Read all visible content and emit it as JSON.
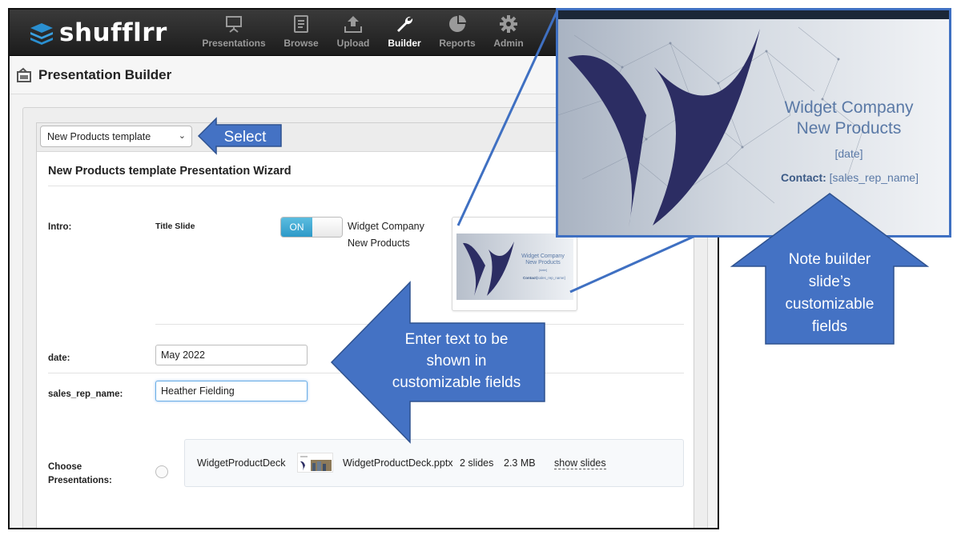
{
  "app": {
    "brand": "shufflrr",
    "nav": [
      {
        "label": "Presentations",
        "icon": "presentation-icon",
        "active": false
      },
      {
        "label": "Browse",
        "icon": "browse-icon",
        "active": false
      },
      {
        "label": "Upload",
        "icon": "upload-icon",
        "active": false
      },
      {
        "label": "Builder",
        "icon": "wrench-icon",
        "active": true
      },
      {
        "label": "Reports",
        "icon": "pie-chart-icon",
        "active": false
      },
      {
        "label": "Admin",
        "icon": "gear-icon",
        "active": false
      }
    ]
  },
  "page": {
    "title": "Presentation Builder"
  },
  "builder": {
    "template_select": {
      "value": "New Products template"
    },
    "wizard_title": "New Products template Presentation Wizard",
    "intro": {
      "label": "Intro:",
      "slide_label": "Title Slide",
      "toggle": "ON",
      "toggle_state": true,
      "preview_lines": [
        "Widget Company",
        "New Products"
      ],
      "thumb": {
        "title_lines": [
          "Widget Company",
          "New Products"
        ],
        "date": "[date]",
        "contact_label": "Contact:",
        "contact_value": "[sales_rep_name]"
      }
    },
    "fields": [
      {
        "label": "date:",
        "value": "May 2022"
      },
      {
        "label": "sales_rep_name:",
        "value": "Heather Fielding"
      }
    ],
    "choose": {
      "label_lines": [
        "Choose",
        "Presentations:"
      ],
      "deck_name": "WidgetProductDeck",
      "file_name": "WidgetProductDeck.pptx",
      "slides": "2 slides",
      "size": "2.3 MB",
      "link": "show slides"
    }
  },
  "preview": {
    "title_lines": [
      "Widget Company",
      "New Products"
    ],
    "date": "[date]",
    "contact_label": "Contact:",
    "contact_value": "[sales_rep_name]"
  },
  "annotations": {
    "select": "Select",
    "enter_text": [
      "Enter text to be",
      "shown in",
      "customizable fields"
    ],
    "note": [
      "Note builder",
      "slide’s",
      "customizable",
      "fields"
    ]
  },
  "colors": {
    "callout": "#4472c4",
    "callout_stroke": "#2f528f",
    "toggle_on": "#34a3d2",
    "slide_navy": "#2c2d63",
    "slide_text": "#5a79a6"
  }
}
